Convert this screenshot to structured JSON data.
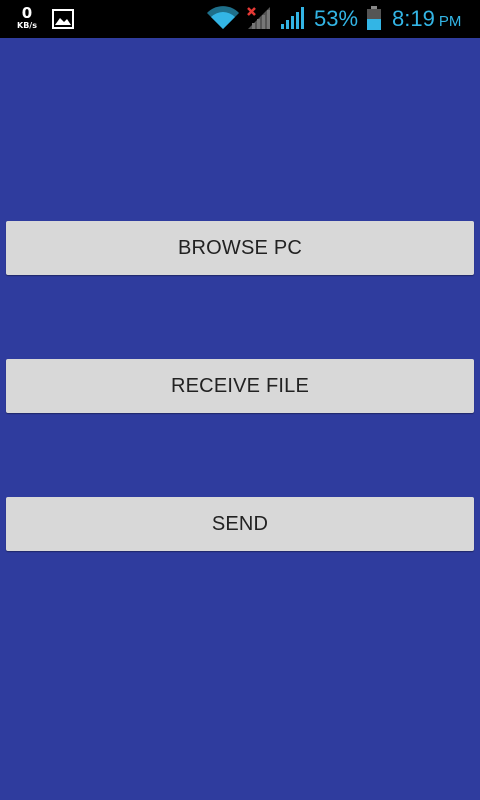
{
  "status_bar": {
    "net_speed_value": "0",
    "net_speed_unit": "KB/s",
    "battery_percent": "53%",
    "time": "8:19",
    "ampm": "PM",
    "icons": [
      "image-notification-icon",
      "wifi-icon",
      "signal-no-data-icon",
      "signal-icon",
      "battery-icon"
    ],
    "accent_color": "#33b5e5"
  },
  "main": {
    "background_color": "#2f3c9e",
    "buttons": [
      {
        "label": "BROWSE PC"
      },
      {
        "label": "RECEIVE FILE"
      },
      {
        "label": "SEND"
      }
    ],
    "button_color": "#d8d8d8"
  }
}
